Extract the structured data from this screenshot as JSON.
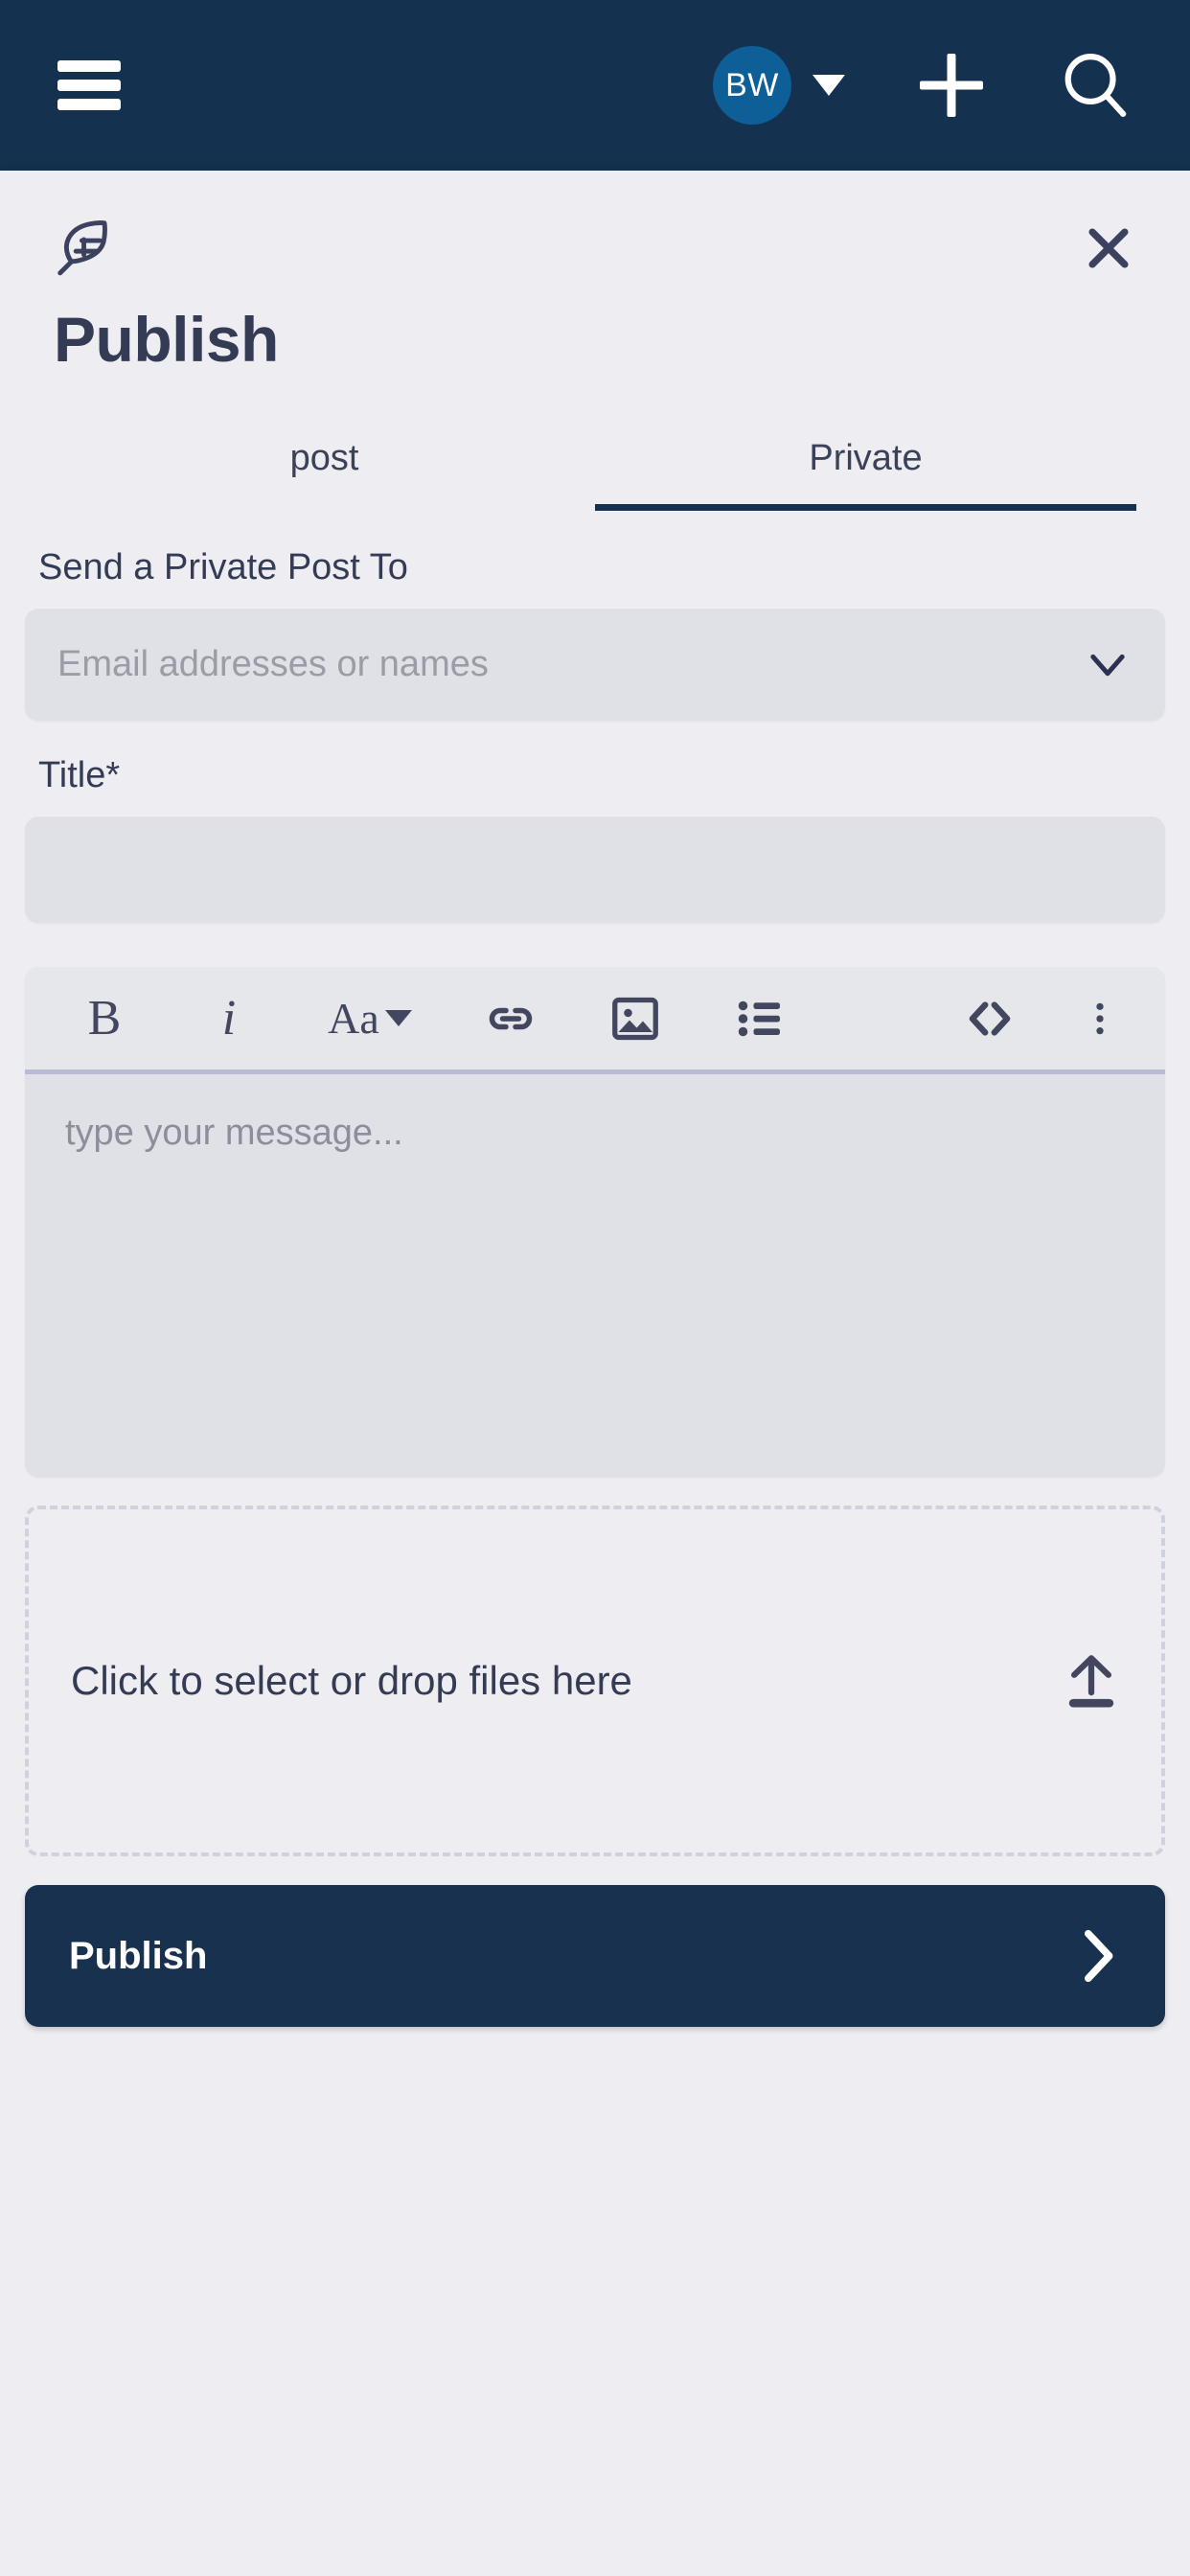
{
  "theme": {
    "topbar_bg": "#14314f",
    "page_bg": "#eeeef2",
    "field_bg": "#e0e1e6",
    "accent_navy": "#17314f",
    "avatar_bg": "#0e5e97",
    "text_dark": "#343b55",
    "placeholder": "#9b9ca6",
    "toolbar_divider": "#b9bad4",
    "dropzone_border": "#cfd1dc"
  },
  "topbar": {
    "menu_icon": "hamburger-menu-icon",
    "avatar_initials": "BW",
    "avatar_caret_icon": "caret-down-icon",
    "add_icon": "plus-icon",
    "search_icon": "search-icon"
  },
  "panel": {
    "brand_icon": "feather-icon",
    "close_icon": "close-icon",
    "title": "Publish",
    "tabs": [
      {
        "label": "post",
        "active": false
      },
      {
        "label": "Private",
        "active": true
      }
    ]
  },
  "form": {
    "recipients": {
      "label": "Send a Private Post To",
      "placeholder": "Email addresses or names",
      "value": "",
      "dropdown_icon": "chevron-down-icon"
    },
    "title": {
      "label": "Title*",
      "placeholder": "",
      "value": ""
    },
    "editor": {
      "placeholder": "type your message...",
      "value": "",
      "toolbar": [
        {
          "name": "bold-button",
          "label": "B",
          "icon": "bold-icon"
        },
        {
          "name": "italic-button",
          "label": "i",
          "icon": "italic-icon"
        },
        {
          "name": "font-size-button",
          "label": "Aa",
          "icon": "font-size-icon"
        },
        {
          "name": "link-button",
          "label": "",
          "icon": "link-icon"
        },
        {
          "name": "image-button",
          "label": "",
          "icon": "image-icon"
        },
        {
          "name": "bullet-list-button",
          "label": "",
          "icon": "bullet-list-icon"
        },
        {
          "name": "code-button",
          "label": "",
          "icon": "code-icon"
        },
        {
          "name": "more-options-button",
          "label": "",
          "icon": "more-vertical-icon"
        }
      ]
    },
    "dropzone": {
      "text": "Click to select or drop files here",
      "icon": "upload-icon"
    },
    "submit": {
      "label": "Publish",
      "icon": "chevron-right-icon"
    }
  }
}
